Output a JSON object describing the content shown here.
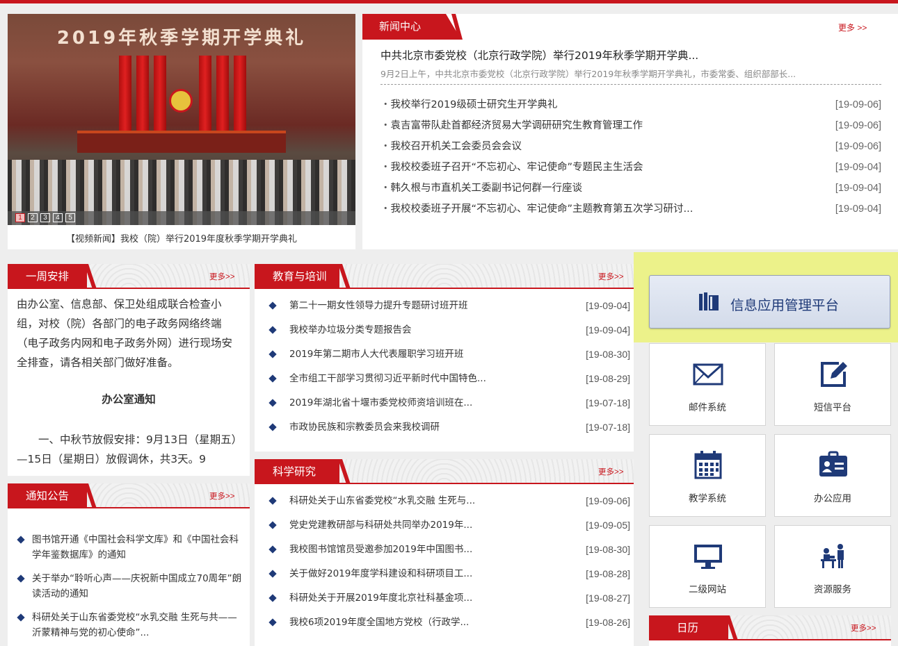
{
  "slideshow": {
    "banner": "2019年秋季学期开学典礼",
    "dots": [
      "1",
      "2",
      "3",
      "4",
      "5"
    ],
    "caption": "【视频新闻】我校（院）举行2019年度秋季学期开学典礼"
  },
  "news_center": {
    "title": "新闻中心",
    "more": "更多 >>",
    "headline": "中共北京市委党校（北京行政学院）举行2019年秋季学期开学典...",
    "summary": "9月2日上午，中共北京市委党校（北京行政学院）举行2019年秋季学期开学典礼，市委常委、组织部部长...",
    "items": [
      {
        "title": "我校举行2019级硕士研究生开学典礼",
        "date": "[19-09-06]"
      },
      {
        "title": "袁吉富带队赴首都经济贸易大学调研研究生教育管理工作",
        "date": "[19-09-06]"
      },
      {
        "title": "我校召开机关工会委员会会议",
        "date": "[19-09-06]"
      },
      {
        "title": "我校校委班子召开“不忘初心、牢记使命”专题民主生活会",
        "date": "[19-09-04]"
      },
      {
        "title": "韩久根与市直机关工委副书记何群一行座谈",
        "date": "[19-09-04]"
      },
      {
        "title": "我校校委班子开展“不忘初心、牢记使命”主题教育第五次学习研讨...",
        "date": "[19-09-04]"
      }
    ]
  },
  "weekly": {
    "title": "一周安排",
    "more": "更多>>",
    "paragraph1": "由办公室、信息部、保卫处组成联合检查小组，对校（院）各部门的电子政务网络终端（电子政务内网和电子政务外网）进行现场安全排查，请各相关部门做好准备。",
    "notice_title": "办公室通知",
    "paragraph2": "一、中秋节放假安排：9月13日（星期五）—15日（星期日）放假调休，共3天。9"
  },
  "notices": {
    "title": "通知公告",
    "more": "更多>>",
    "items": [
      "图书馆开通《中国社会科学文库》和《中国社会科学年鉴数据库》的通知",
      "关于举办“聆听心声——庆祝新中国成立70周年”朗读活动的通知",
      "科研处关于山东省委党校“水乳交融 生死与共——沂蒙精神与党的初心使命”..."
    ]
  },
  "education": {
    "title": "教育与培训",
    "more": "更多>>",
    "items": [
      {
        "title": "第二十一期女性领导力提升专题研讨班开班",
        "date": "[19-09-04]"
      },
      {
        "title": "我校举办垃圾分类专题报告会",
        "date": "[19-09-04]"
      },
      {
        "title": "2019年第二期市人大代表履职学习班开班",
        "date": "[19-08-30]"
      },
      {
        "title": "全市组工干部学习贯彻习近平新时代中国特色...",
        "date": "[19-08-29]"
      },
      {
        "title": "2019年湖北省十堰市委党校师资培训班在...",
        "date": "[19-07-18]"
      },
      {
        "title": "市政协民族和宗教委员会来我校调研",
        "date": "[19-07-18]"
      }
    ]
  },
  "research": {
    "title": "科学研究",
    "more": "更多>>",
    "items": [
      {
        "title": "科研处关于山东省委党校“水乳交融 生死与...",
        "date": "[19-09-06]"
      },
      {
        "title": "党史党建教研部与科研处共同举办2019年...",
        "date": "[19-09-05]"
      },
      {
        "title": "我校图书馆馆员受邀参加2019年中国图书...",
        "date": "[19-08-30]"
      },
      {
        "title": "关于做好2019年度学科建设和科研项目工...",
        "date": "[19-08-28]"
      },
      {
        "title": "科研处关于开展2019年度北京社科基金项...",
        "date": "[19-08-27]"
      },
      {
        "title": "我校6项2019年度全国地方党校（行政学...",
        "date": "[19-08-26]"
      }
    ]
  },
  "platform": {
    "label": "信息应用管理平台",
    "icon": "books-icon"
  },
  "apps": [
    {
      "label": "邮件系统",
      "icon": "mail-icon"
    },
    {
      "label": "短信平台",
      "icon": "edit-icon"
    },
    {
      "label": "教学系统",
      "icon": "calendar-icon"
    },
    {
      "label": "办公应用",
      "icon": "id-card-icon"
    },
    {
      "label": "二级网站",
      "icon": "monitor-icon"
    },
    {
      "label": "资源服务",
      "icon": "service-icon"
    }
  ],
  "calendar": {
    "title": "日历",
    "more": "更多>>"
  },
  "colors": {
    "accent": "#c8161d",
    "icon_blue": "#1f3a78",
    "highlight": "#ecf28a"
  }
}
